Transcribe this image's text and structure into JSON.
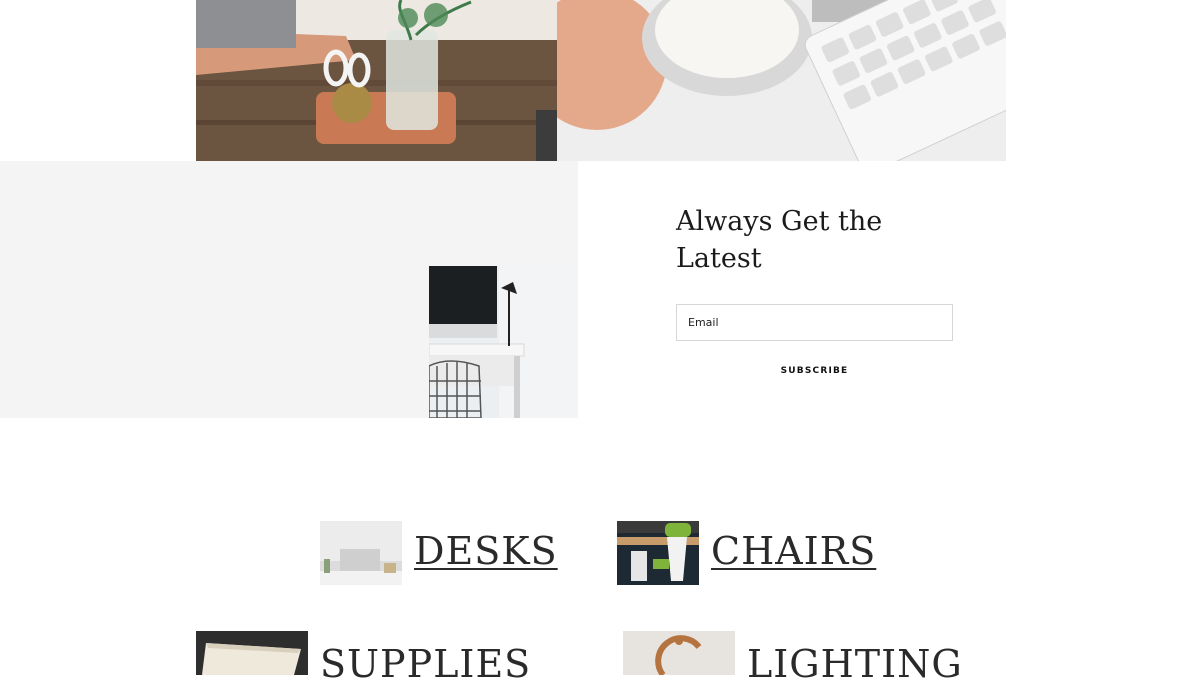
{
  "newsletter": {
    "title_line1": "Always Get the",
    "title_line2": "Latest",
    "email_placeholder": "Email",
    "subscribe_label": "SUBSCRIBE"
  },
  "categories": [
    {
      "label": "DESKS"
    },
    {
      "label": "CHAIRS"
    },
    {
      "label": "SUPPLIES"
    },
    {
      "label": "LIGHTING"
    }
  ],
  "colors": {
    "band_background": "#f4f4f4",
    "text": "#1b1b1b",
    "input_border": "#d6d6d6"
  }
}
